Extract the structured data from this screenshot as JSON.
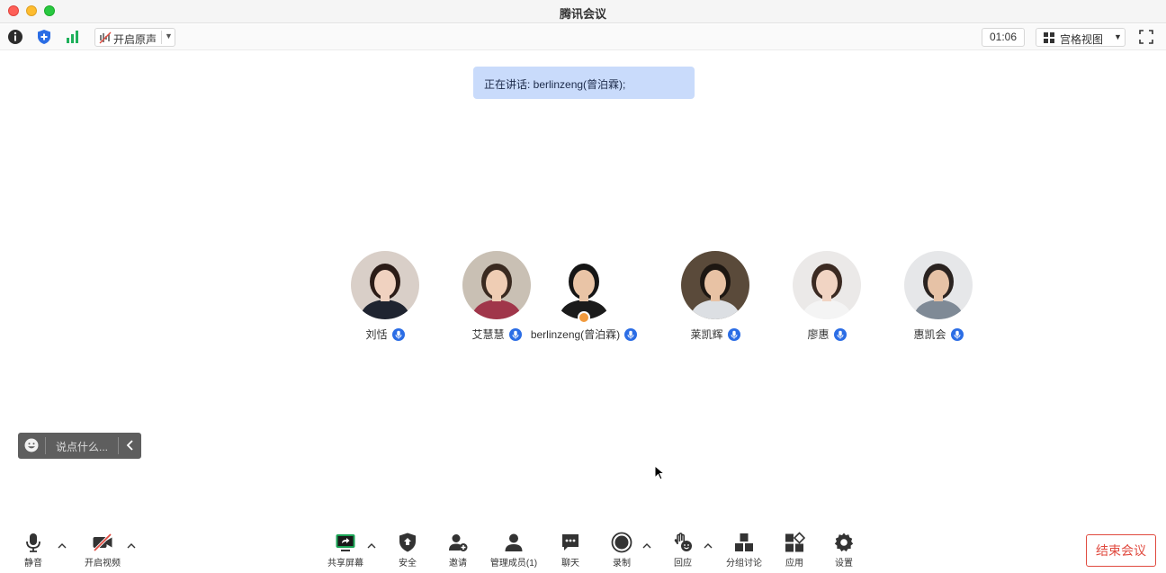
{
  "window": {
    "title": "腾讯会议"
  },
  "topbar": {
    "original_sound_label": "开启原声",
    "timer": "01:06",
    "view_label": "宫格视图"
  },
  "banner": {
    "speaking_text": "正在讲话: berlinzeng(曾泊霖);"
  },
  "participants": [
    {
      "name": "刘恬",
      "avatar_bg": "#d9cfc8",
      "hair": "#2b1c17",
      "cloth": "#1f2430",
      "skin": "#f0d2c0"
    },
    {
      "name": "艾慧慧",
      "avatar_bg": "#c9c0b4",
      "hair": "#3a2a20",
      "cloth": "#a0364a",
      "skin": "#efcdb4"
    },
    {
      "name": "berlinzeng(曾泊霖)",
      "avatar_bg": "#ffffff",
      "hair": "#151515",
      "cloth": "#1b1b1b",
      "skin": "#e9c4a6",
      "host": true
    },
    {
      "name": "莱凯辉",
      "avatar_bg": "#5a4a3a",
      "hair": "#1d1712",
      "cloth": "#dcdfe3",
      "skin": "#e8c2a4"
    },
    {
      "name": "廖惠",
      "avatar_bg": "#ebe9e8",
      "hair": "#3b2a22",
      "cloth": "#f4f4f4",
      "skin": "#f1d4c3"
    },
    {
      "name": "惠凯会",
      "avatar_bg": "#e6e7e9",
      "hair": "#2a2320",
      "cloth": "#7f8a96",
      "skin": "#e6c2a6"
    }
  ],
  "chat": {
    "placeholder": "说点什么..."
  },
  "bottombar": {
    "mute_label": "静音",
    "video_label": "开启视频",
    "share_label": "共享屏幕",
    "security_label": "安全",
    "invite_label": "邀请",
    "members_label": "管理成员(1)",
    "chat_label": "聊天",
    "record_label": "录制",
    "reaction_label": "回应",
    "breakout_label": "分组讨论",
    "apps_label": "应用",
    "settings_label": "设置",
    "end_label": "结束会议"
  },
  "colors": {
    "accent_blue": "#2b6de5",
    "banner_bg": "#c9dbfb",
    "end_red": "#e04a3f",
    "share_green": "#19a354"
  }
}
